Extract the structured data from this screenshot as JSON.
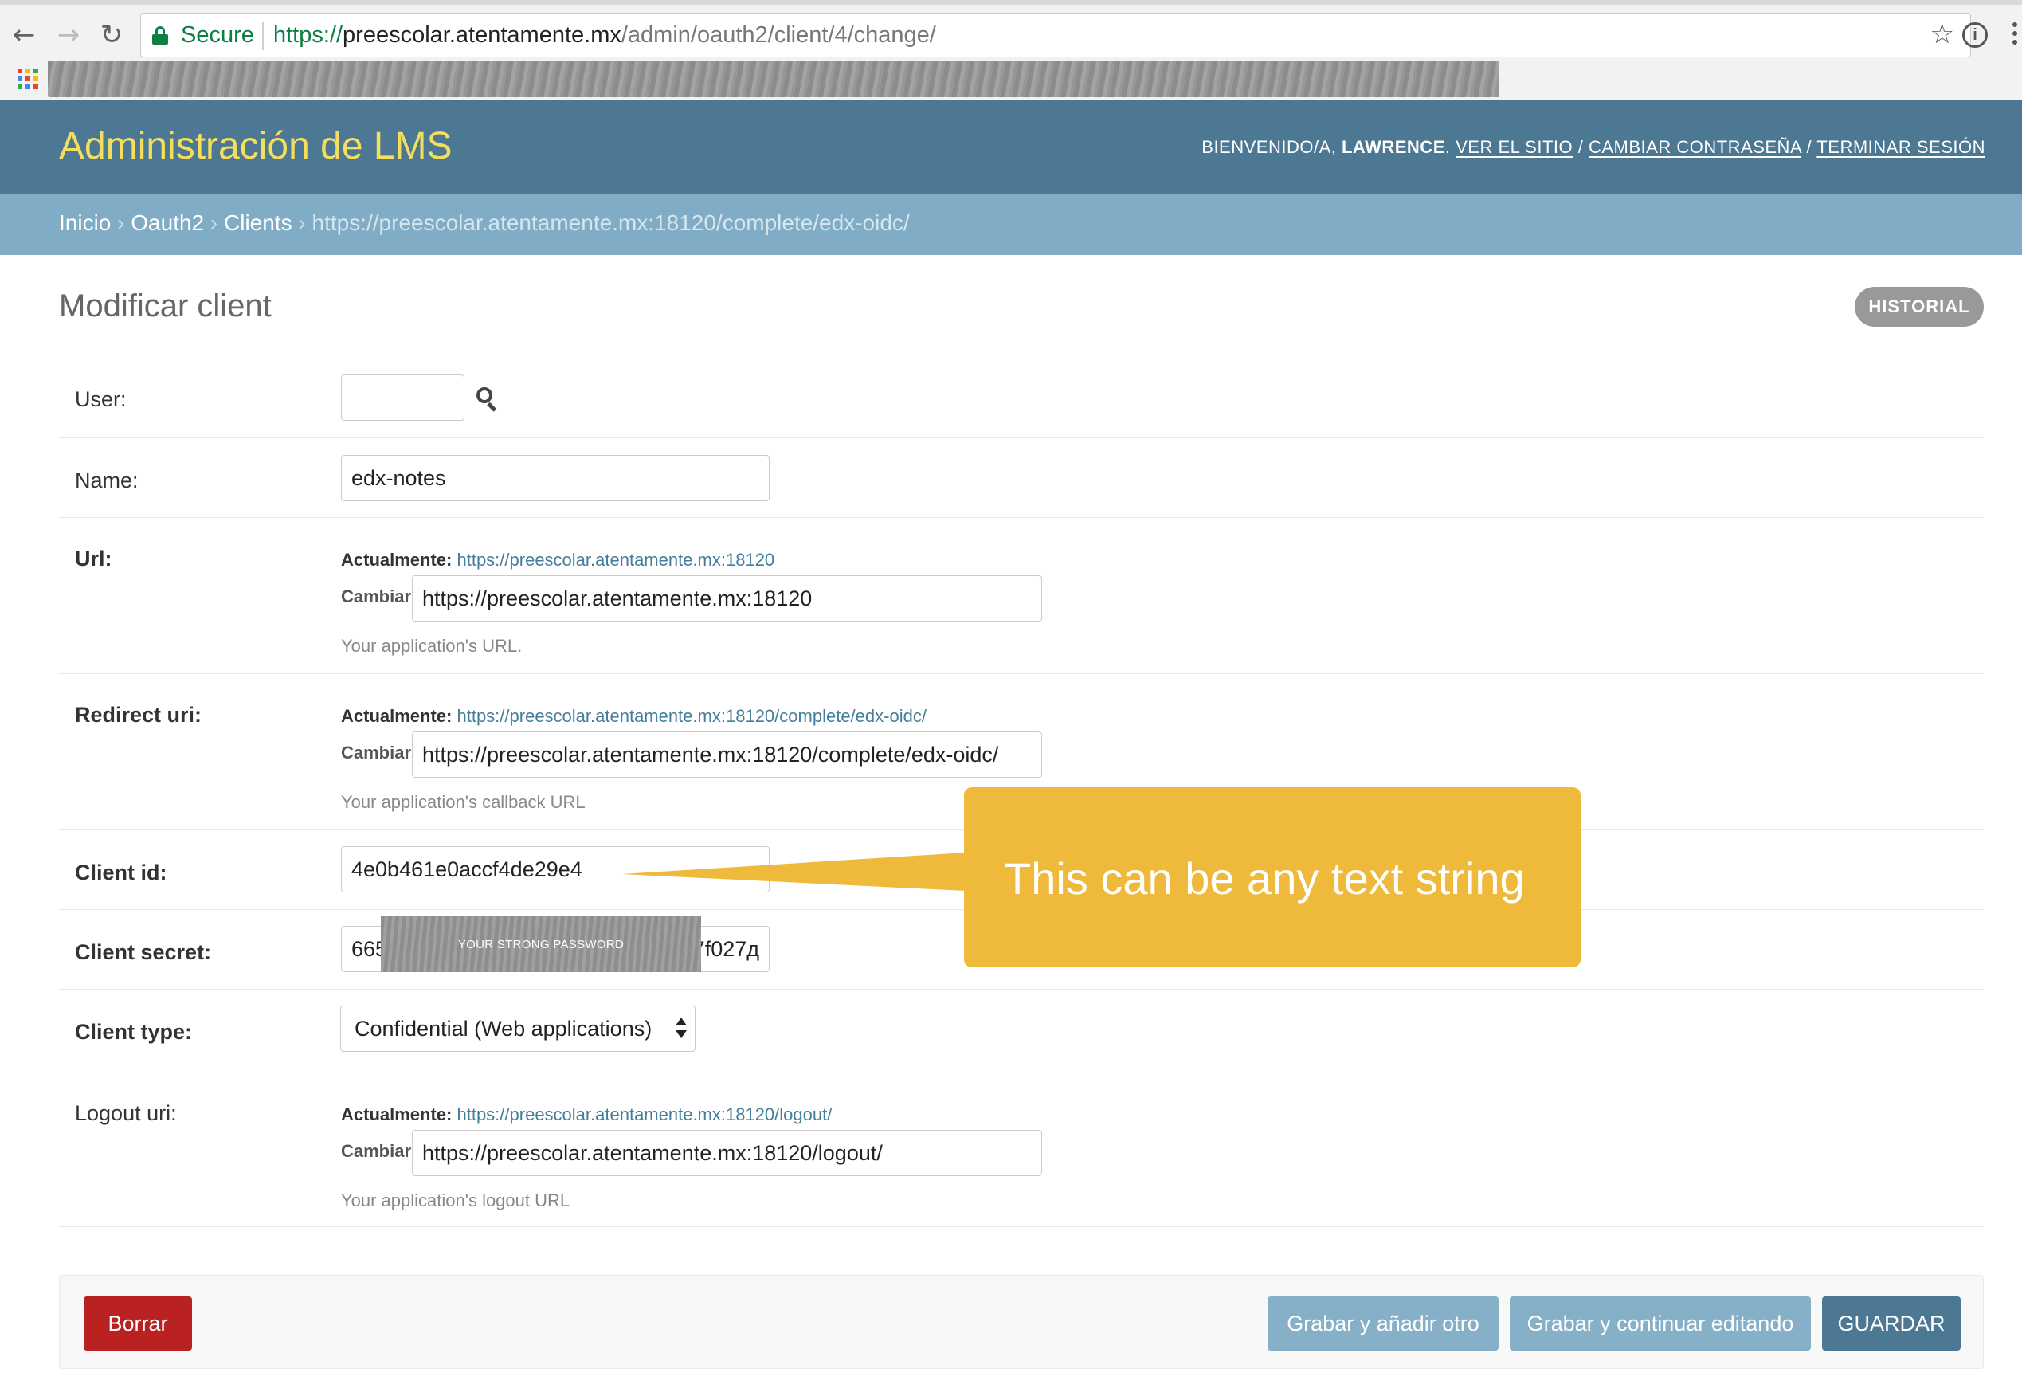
{
  "browser": {
    "secure_label": "Secure",
    "url_scheme": "https://",
    "url_host": "preescolar.atentamente.mx",
    "url_path": "/admin/oauth2/client/4/change/"
  },
  "header": {
    "branding": "Administración de LMS",
    "welcome": "BIENVENIDO/A,",
    "username": "LAWRENCE",
    "view_site": "VER EL SITIO",
    "change_password": "CAMBIAR CONTRASEÑA",
    "logout": "TERMINAR SESIÓN",
    "separator": " / "
  },
  "breadcrumbs": {
    "home": "Inicio",
    "app": "Oauth2",
    "model": "Clients",
    "current": "https://preescolar.atentamente.mx:18120/complete/edx-oidc/",
    "separator": " › "
  },
  "page": {
    "title": "Modificar client",
    "history_label": "HISTORIAL"
  },
  "form": {
    "user": {
      "label": "User:",
      "value": ""
    },
    "name": {
      "label": "Name:",
      "value": "edx-notes"
    },
    "url": {
      "label": "Url:",
      "current_label": "Actualmente:",
      "current_value": "https://preescolar.atentamente.mx:18120",
      "change_label": "Cambiar:",
      "value": "https://preescolar.atentamente.mx:18120",
      "help": "Your application's URL."
    },
    "redirect_uri": {
      "label": "Redirect uri:",
      "current_label": "Actualmente:",
      "current_value": "https://preescolar.atentamente.mx:18120/complete/edx-oidc/",
      "change_label": "Cambiar:",
      "value": "https://preescolar.atentamente.mx:18120/complete/edx-oidc/",
      "help": "Your application's callback URL"
    },
    "client_id": {
      "label": "Client id:",
      "value": "4e0b461e0accf4de29e4"
    },
    "client_secret": {
      "label": "Client secret:",
      "value_start": "665",
      "value_end": "57f027д",
      "redaction_text": "YOUR STRONG PASSWORD"
    },
    "client_type": {
      "label": "Client type:",
      "selected": "Confidential (Web applications)"
    },
    "logout_uri": {
      "label": "Logout uri:",
      "current_label": "Actualmente:",
      "current_value": "https://preescolar.atentamente.mx:18120/logout/",
      "change_label": "Cambiar:",
      "value": "https://preescolar.atentamente.mx:18120/logout/",
      "help": "Your application's logout URL"
    }
  },
  "callout": {
    "text": "This can be any text string",
    "color": "#efb93b"
  },
  "submit": {
    "delete": "Borrar",
    "save_add_another": "Grabar y añadir otro",
    "save_continue": "Grabar y continuar editando",
    "save": "GUARDAR"
  },
  "colors": {
    "header_bg": "#4c7893",
    "branding": "#f5dd5d",
    "breadcrumbs_bg": "#81acc6",
    "delete": "#ba2121",
    "button": "#86b0c8",
    "default_button": "#4c7893"
  }
}
